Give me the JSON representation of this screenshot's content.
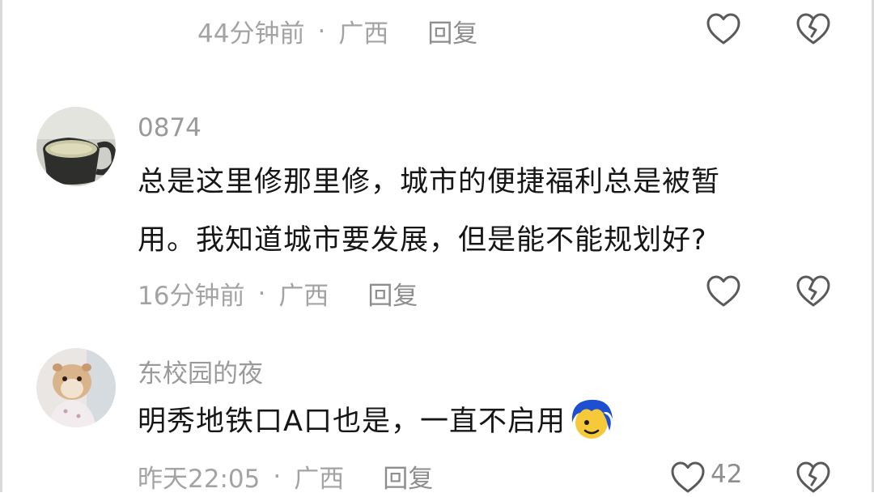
{
  "comments": [
    {
      "username": "",
      "text": "",
      "time": "44分钟前",
      "location": "广西",
      "reply_label": "回复",
      "like_count": ""
    },
    {
      "username": "0874",
      "text_line1": "总是这里修那里修，城市的便捷福利总是被暂",
      "text_line2": "用。我知道城市要发展，但是能不能规划好?",
      "time": "16分钟前",
      "location": "广西",
      "reply_label": "回复",
      "like_count": ""
    },
    {
      "username": "东校园的夜",
      "text": "明秀地铁口A口也是，一直不启用",
      "emoji_icon": "blue-hair-face-emoji",
      "time": "昨天22:05",
      "location": "广西",
      "reply_label": "回复",
      "like_count": "42"
    }
  ],
  "separator": "·",
  "icons": {
    "like": "heart-outline-icon",
    "dislike": "broken-heart-icon"
  },
  "colors": {
    "text": "#161616",
    "meta": "#a3a3a3",
    "icon": "#5a5a5a"
  }
}
